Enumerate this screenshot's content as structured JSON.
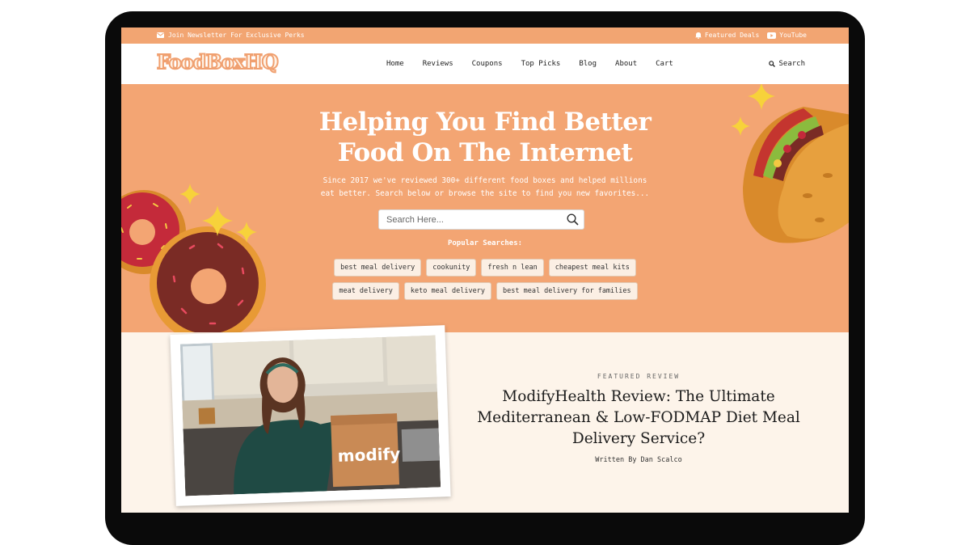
{
  "topbar": {
    "newsletter": "Join Newsletter For Exclusive Perks",
    "deals": "Featured Deals",
    "youtube": "YouTube"
  },
  "header": {
    "logo": "FoodBoxHQ",
    "nav": [
      "Home",
      "Reviews",
      "Coupons",
      "Top Picks",
      "Blog",
      "About",
      "Cart"
    ],
    "search_label": "Search"
  },
  "hero": {
    "title_line1": "Helping You Find Better",
    "title_line2": "Food On The Internet",
    "subtitle_line1": "Since 2017 we've reviewed 300+ different food boxes and helped millions",
    "subtitle_line2": "eat better. Search below or browse the site to find you new favorites...",
    "search_placeholder": "Search Here...",
    "popular_label": "Popular Searches:",
    "chips_row1": [
      "best meal delivery",
      "cookunity",
      "fresh n lean",
      "cheapest meal kits"
    ],
    "chips_row2": [
      "meat delivery",
      "keto meal delivery",
      "best meal delivery for families"
    ]
  },
  "featured": {
    "eyebrow": "FEATURED REVIEW",
    "title_line1": "ModifyHealth Review: The Ultimate",
    "title_line2": "Mediterranean & Low-FODMAP Diet Meal",
    "title_line3": "Delivery Service?",
    "byline": "Written By Dan Scalco",
    "box_text": "modify"
  },
  "colors": {
    "accent": "#f3a573",
    "cream": "#fdf4ea",
    "tablet": "#0a0a0a"
  }
}
